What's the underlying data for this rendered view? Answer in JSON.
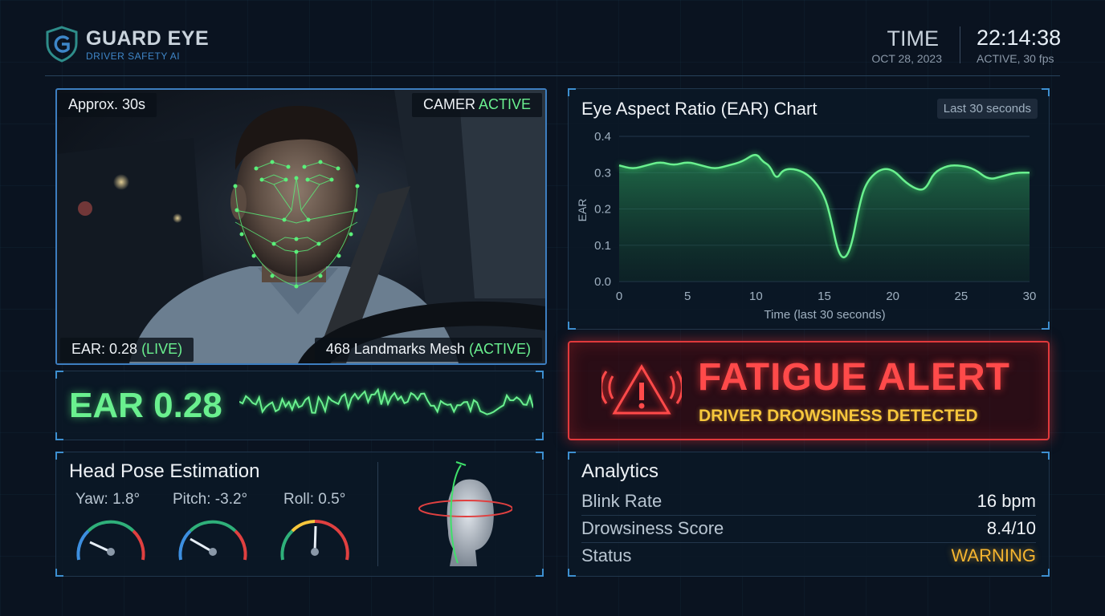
{
  "header": {
    "brand": "GUARD EYE",
    "brand_sub": "DRIVER SAFETY AI",
    "time_label": "TIME",
    "date": "OCT 28, 2023",
    "clock": "22:14:38",
    "status": "ACTIVE, 30 fps"
  },
  "camera": {
    "duration": "Approx. 30s",
    "camera_label": "CAMER",
    "camera_state": "ACTIVE",
    "ear_label": "EAR: 0.28",
    "ear_state": "(LIVE)",
    "mesh_label": "468 Landmarks Mesh",
    "mesh_state": "(ACTIVE)"
  },
  "ear_live": {
    "label": "EAR 0.28",
    "value": 0.28
  },
  "head_pose": {
    "title": "Head Pose Estimation",
    "gauges": [
      {
        "label": "Yaw: 1.8°",
        "value": 1.8
      },
      {
        "label": "Pitch: -3.2°",
        "value": -3.2
      },
      {
        "label": "Roll: 0.5°",
        "value": 0.5
      }
    ]
  },
  "ear_chart": {
    "title": "Eye Aspect Ratio (EAR) Chart",
    "badge": "Last 30 seconds"
  },
  "chart_data": {
    "type": "area",
    "title": "Eye Aspect Ratio (EAR) Chart",
    "xlabel": "Time (last 30 seconds)",
    "ylabel": "EAR",
    "xlim": [
      0,
      30
    ],
    "ylim": [
      0,
      0.4
    ],
    "x_ticks": [
      "0",
      "5",
      "10",
      "15",
      "20",
      "25",
      "30"
    ],
    "y_ticks": [
      "0.0",
      "0.1",
      "0.2",
      "0.3",
      "0.4"
    ],
    "grid": true,
    "series": [
      {
        "x": [
          0,
          1,
          2,
          3,
          4,
          5,
          6,
          7,
          8,
          9,
          10,
          10.5,
          11,
          11.5,
          12,
          13,
          14,
          15,
          15.5,
          16,
          16.5,
          17,
          17.5,
          18,
          19,
          20,
          21,
          22,
          22.5,
          23,
          24,
          25,
          26,
          27,
          28,
          29,
          30
        ],
        "values": [
          0.32,
          0.31,
          0.32,
          0.33,
          0.32,
          0.33,
          0.32,
          0.31,
          0.32,
          0.33,
          0.355,
          0.33,
          0.32,
          0.28,
          0.31,
          0.31,
          0.29,
          0.24,
          0.17,
          0.08,
          0.06,
          0.1,
          0.2,
          0.27,
          0.31,
          0.31,
          0.27,
          0.25,
          0.26,
          0.3,
          0.32,
          0.32,
          0.31,
          0.28,
          0.29,
          0.3,
          0.3
        ]
      }
    ]
  },
  "alert": {
    "title": "FATIGUE ALERT",
    "subtitle": "DRIVER DROWSINESS DETECTED"
  },
  "analytics": {
    "title": "Analytics",
    "rows": [
      {
        "key": "Blink Rate",
        "value": "16 bpm"
      },
      {
        "key": "Drowsiness Score",
        "value": "8.4/10"
      },
      {
        "key": "Status",
        "value": "WARNING"
      }
    ]
  },
  "colors": {
    "accent_green": "#6af08f",
    "alert_red": "#ff4a4a",
    "warning_amber": "#f6b530",
    "frame_blue": "#3d7ec0"
  }
}
